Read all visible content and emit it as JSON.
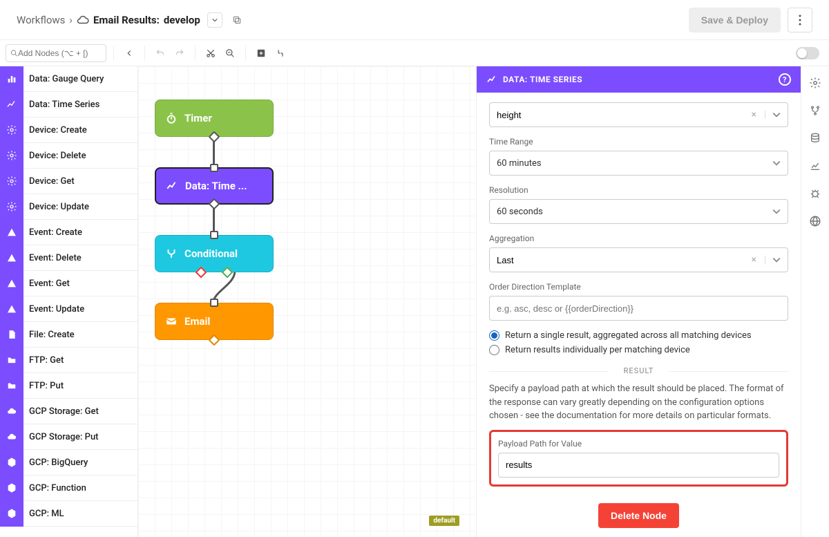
{
  "breadcrumb": {
    "root": "Workflows",
    "separator": "›",
    "title": "Email Results:",
    "branch": "develop"
  },
  "header": {
    "save_label": "Save & Deploy"
  },
  "toolbar": {
    "search_placeholder": "Add Nodes (⌥ + [)"
  },
  "palette": [
    {
      "label": "Data: Gauge Query",
      "icon": "bar-chart"
    },
    {
      "label": "Data: Time Series",
      "icon": "line-chart"
    },
    {
      "label": "Device: Create",
      "icon": "gear-plus"
    },
    {
      "label": "Device: Delete",
      "icon": "gear-minus"
    },
    {
      "label": "Device: Get",
      "icon": "gear-down"
    },
    {
      "label": "Device: Update",
      "icon": "gear-check"
    },
    {
      "label": "Event: Create",
      "icon": "triangle-plus"
    },
    {
      "label": "Event: Delete",
      "icon": "triangle-minus"
    },
    {
      "label": "Event: Get",
      "icon": "triangle-down"
    },
    {
      "label": "Event: Update",
      "icon": "triangle-check"
    },
    {
      "label": "File: Create",
      "icon": "file"
    },
    {
      "label": "FTP: Get",
      "icon": "folder-down"
    },
    {
      "label": "FTP: Put",
      "icon": "folder-up"
    },
    {
      "label": "GCP Storage: Get",
      "icon": "cloud-down"
    },
    {
      "label": "GCP Storage: Put",
      "icon": "cloud-up"
    },
    {
      "label": "GCP: BigQuery",
      "icon": "hex"
    },
    {
      "label": "GCP: Function",
      "icon": "hex"
    },
    {
      "label": "GCP: ML",
      "icon": "hex"
    }
  ],
  "canvas": {
    "nodes": {
      "timer": "Timer",
      "data": "Data: Time ...",
      "cond": "Conditional",
      "email": "Email"
    },
    "default_tag": "default"
  },
  "panel": {
    "title": "DATA: TIME SERIES",
    "attribute_value": "height",
    "time_range_label": "Time Range",
    "time_range_value": "60 minutes",
    "resolution_label": "Resolution",
    "resolution_value": "60 seconds",
    "aggregation_label": "Aggregation",
    "aggregation_value": "Last",
    "order_label": "Order Direction Template",
    "order_placeholder": "e.g. asc, desc or {{orderDirection}}",
    "radio1": "Return a single result, aggregated across all matching devices",
    "radio2": "Return results individually per matching device",
    "result_title": "RESULT",
    "result_desc": "Specify a payload path at which the result should be placed. The format of the response can vary greatly depending on the configuration options chosen - see the documentation for more details on particular formats.",
    "payload_label": "Payload Path for Value",
    "payload_value": "results",
    "delete_label": "Delete Node"
  }
}
